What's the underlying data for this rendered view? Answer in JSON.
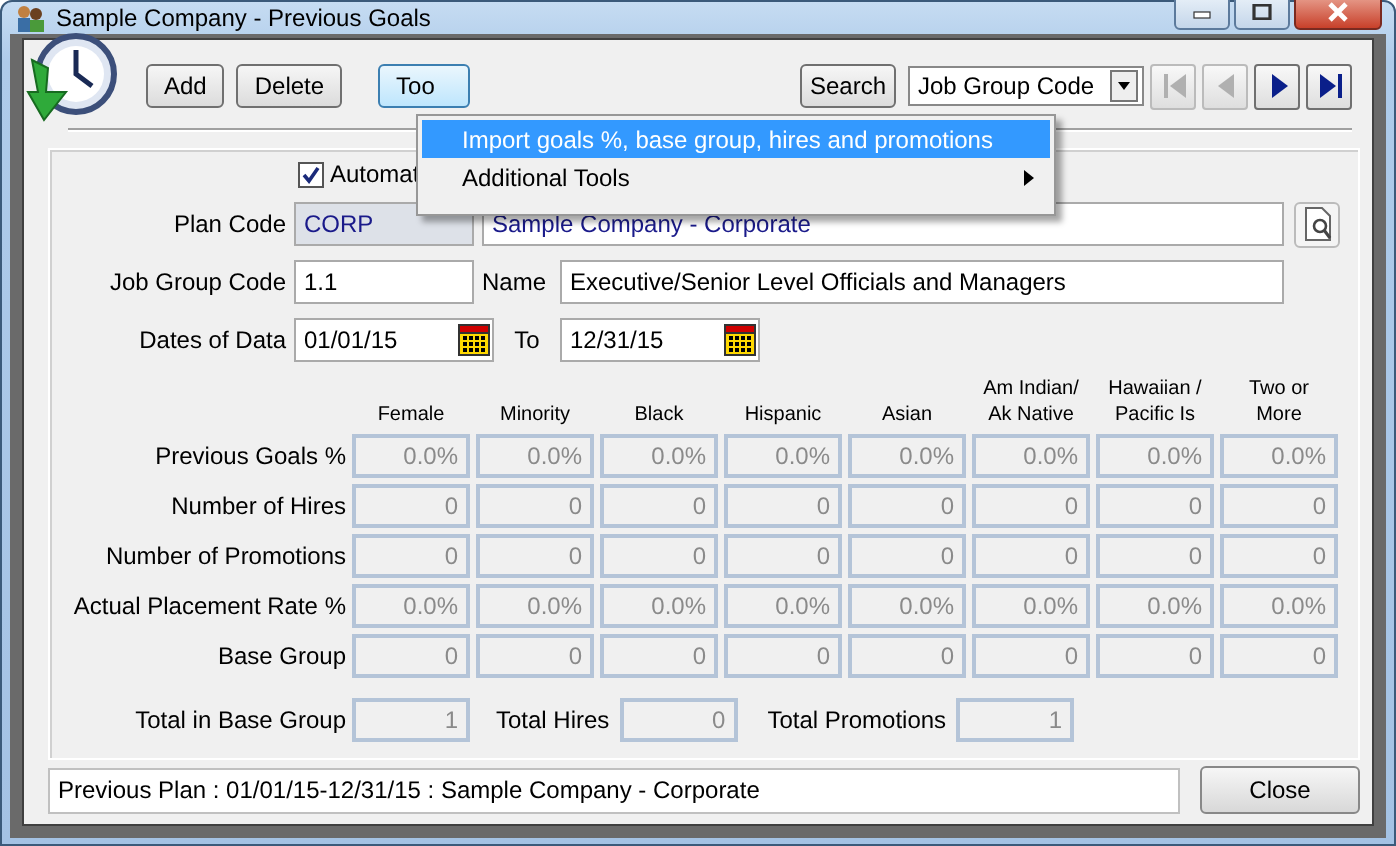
{
  "window": {
    "title": "Sample Company - Previous Goals"
  },
  "toolbar": {
    "buttons": [
      {
        "label": "Add"
      },
      {
        "label": "Delete"
      },
      {
        "label": "Too"
      }
    ],
    "search_button": "Search",
    "search_field": {
      "value": "Job Group Code"
    },
    "nav_buttons": [
      {
        "kind": "first",
        "disabled": true
      },
      {
        "kind": "prev",
        "disabled": true
      },
      {
        "kind": "next",
        "disabled": false
      },
      {
        "kind": "last",
        "disabled": false
      }
    ]
  },
  "menu": {
    "items": [
      {
        "label": "Import goals %, base group, hires and promotions",
        "selected": true,
        "submenu": false
      },
      {
        "label": "Additional Tools",
        "selected": false,
        "submenu": true
      }
    ]
  },
  "automatic_checkbox": {
    "label": "Automat",
    "checked": true
  },
  "plan_code": {
    "label": "Plan Code",
    "code": "CORP",
    "name": "Sample Company - Corporate"
  },
  "job_group": {
    "label": "Job Group Code",
    "code": "1.1",
    "name_label": "Name",
    "name": "Executive/Senior Level Officials and Managers"
  },
  "dates": {
    "label": "Dates of Data",
    "from": "01/01/15",
    "to_label": "To",
    "to": "12/31/15"
  },
  "grid": {
    "columns": [
      "Female",
      "Minority",
      "Black",
      "Hispanic",
      "Asian",
      "Am Indian/\nAk Native",
      "Hawaiian /\nPacific Is",
      "Two or\nMore"
    ],
    "rows": [
      {
        "label": "Previous Goals %",
        "values": [
          "0.0%",
          "0.0%",
          "0.0%",
          "0.0%",
          "0.0%",
          "0.0%",
          "0.0%",
          "0.0%"
        ]
      },
      {
        "label": "Number of Hires",
        "values": [
          "0",
          "0",
          "0",
          "0",
          "0",
          "0",
          "0",
          "0"
        ]
      },
      {
        "label": "Number of Promotions",
        "values": [
          "0",
          "0",
          "0",
          "0",
          "0",
          "0",
          "0",
          "0"
        ]
      },
      {
        "label": "Actual Placement Rate %",
        "values": [
          "0.0%",
          "0.0%",
          "0.0%",
          "0.0%",
          "0.0%",
          "0.0%",
          "0.0%",
          "0.0%"
        ]
      },
      {
        "label": "Base Group",
        "values": [
          "0",
          "0",
          "0",
          "0",
          "0",
          "0",
          "0",
          "0"
        ]
      }
    ]
  },
  "totals": [
    {
      "label": "Total in Base Group",
      "value": "1"
    },
    {
      "label": "Total Hires",
      "value": "0"
    },
    {
      "label": "Total Promotions",
      "value": "1"
    }
  ],
  "status_bar": {
    "text": "Previous Plan : 01/01/15-12/31/15 : Sample Company - Corporate"
  },
  "close_button": "Close"
}
